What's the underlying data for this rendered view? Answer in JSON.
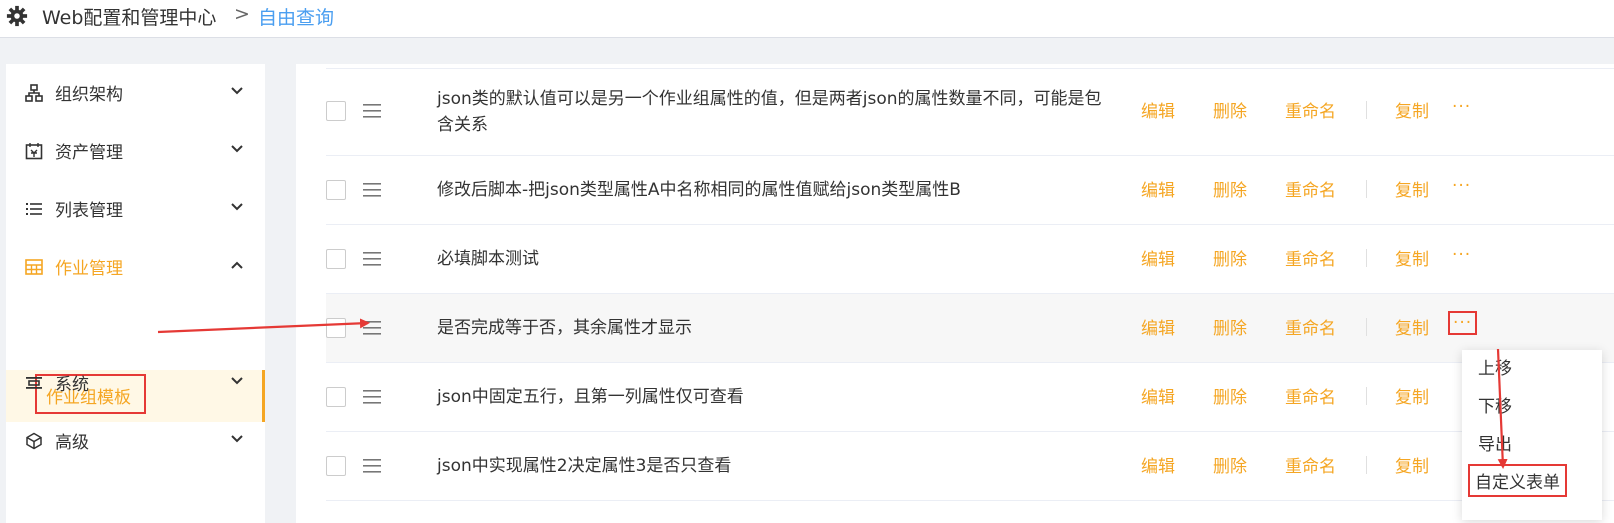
{
  "header": {
    "app_title": "Web配置和管理中心",
    "separator": ">",
    "breadcrumb": "自由查询"
  },
  "sidebar": {
    "items": [
      {
        "label": "组织架构",
        "icon": "org-chart-icon"
      },
      {
        "label": "资产管理",
        "icon": "asset-icon"
      },
      {
        "label": "列表管理",
        "icon": "list-icon"
      },
      {
        "label": "作业管理",
        "icon": "table-grid-icon",
        "active": true
      },
      {
        "label": "系统",
        "icon": "system-icon"
      },
      {
        "label": "高级",
        "icon": "cube-icon"
      }
    ],
    "sub_item": "作业组模板"
  },
  "table": {
    "actions": {
      "edit": "编辑",
      "delete": "删除",
      "rename": "重命名",
      "copy": "复制",
      "more": "···"
    },
    "rows": [
      {
        "title": "json类的默认值可以是另一个作业组属性的值，但是两者json的属性数量不同，可能是包含关系"
      },
      {
        "title": "修改后脚本-把json类型属性A中名称相同的属性值赋给json类型属性B"
      },
      {
        "title": "必填脚本测试"
      },
      {
        "title": "是否完成等于否，其余属性才显示"
      },
      {
        "title": "json中固定五行，且第一列属性仅可查看"
      },
      {
        "title": "json中实现属性2决定属性3是否只查看"
      }
    ]
  },
  "dropdown": {
    "items": [
      "上移",
      "下移",
      "导出",
      "自定义表单"
    ]
  },
  "colors": {
    "accent": "#f5a623",
    "annotation": "#e53935",
    "link": "#4a9ef0"
  }
}
